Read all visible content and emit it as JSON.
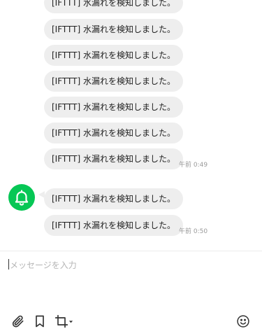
{
  "chat": {
    "messages": [
      {
        "text": "[IFTTT] 水漏れを検知しました。",
        "time": ""
      },
      {
        "text": "[IFTTT] 水漏れを検知しました。",
        "time": ""
      },
      {
        "text": "[IFTTT] 水漏れを検知しました。",
        "time": ""
      },
      {
        "text": "[IFTTT] 水漏れを検知しました。",
        "time": ""
      },
      {
        "text": "[IFTTT] 水漏れを検知しました。",
        "time": ""
      },
      {
        "text": "[IFTTT] 水漏れを検知しました。",
        "time": ""
      },
      {
        "text": "[IFTTT] 水漏れを検知しました。",
        "time": "午前 0:49"
      },
      {
        "text": "[IFTTT] 水漏れを検知しました。",
        "time": ""
      },
      {
        "text": "[IFTTT] 水漏れを検知しました。",
        "time": "午前 0:50"
      }
    ],
    "sender_avatar_icon": "bell-icon",
    "avatar_color": "#06c755",
    "bubble_color": "#eeeeee"
  },
  "composer": {
    "placeholder": "メッセージを入力",
    "tools": [
      {
        "icon": "paperclip-icon"
      },
      {
        "icon": "bookmark-icon"
      },
      {
        "icon": "crop-icon"
      },
      {
        "icon": "emoji-icon"
      }
    ]
  }
}
